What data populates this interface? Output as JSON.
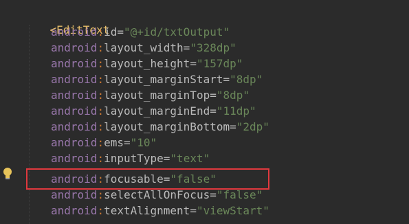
{
  "editor": {
    "colors": {
      "background": "#2b2b2b",
      "tag": "#e8bf6a",
      "namespace": "#9876aa",
      "attribute": "#bababa",
      "value": "#6a8759",
      "highlight_box": "#e0393e"
    },
    "opening_tag": {
      "bracket": "<",
      "name": "EditText"
    },
    "attributes": [
      {
        "ns": "android",
        "colon": ":",
        "name": "id",
        "eq": "=",
        "value": "\"@+id/txtOutput\""
      },
      {
        "ns": "android",
        "colon": ":",
        "name": "layout_width",
        "eq": "=",
        "value": "\"328dp\""
      },
      {
        "ns": "android",
        "colon": ":",
        "name": "layout_height",
        "eq": "=",
        "value": "\"157dp\""
      },
      {
        "ns": "android",
        "colon": ":",
        "name": "layout_marginStart",
        "eq": "=",
        "value": "\"8dp\""
      },
      {
        "ns": "android",
        "colon": ":",
        "name": "layout_marginTop",
        "eq": "=",
        "value": "\"8dp\""
      },
      {
        "ns": "android",
        "colon": ":",
        "name": "layout_marginEnd",
        "eq": "=",
        "value": "\"11dp\""
      },
      {
        "ns": "android",
        "colon": ":",
        "name": "layout_marginBottom",
        "eq": "=",
        "value": "\"2dp\""
      },
      {
        "ns": "android",
        "colon": ":",
        "name": "ems",
        "eq": "=",
        "value": "\"10\""
      },
      {
        "ns": "android",
        "colon": ":",
        "name": "inputType",
        "eq": "=",
        "value": "\"text\""
      },
      {
        "ns": "android",
        "colon": ":",
        "name": "focusable",
        "eq": "=",
        "value": "\"false\""
      },
      {
        "ns": "android",
        "colon": ":",
        "name": "selectAllOnFocus",
        "eq": "=",
        "value": "\"false\""
      },
      {
        "ns": "android",
        "colon": ":",
        "name": "textAlignment",
        "eq": "=",
        "value": "\"viewStart\""
      }
    ],
    "gutter_icon": "lightbulb-icon"
  }
}
